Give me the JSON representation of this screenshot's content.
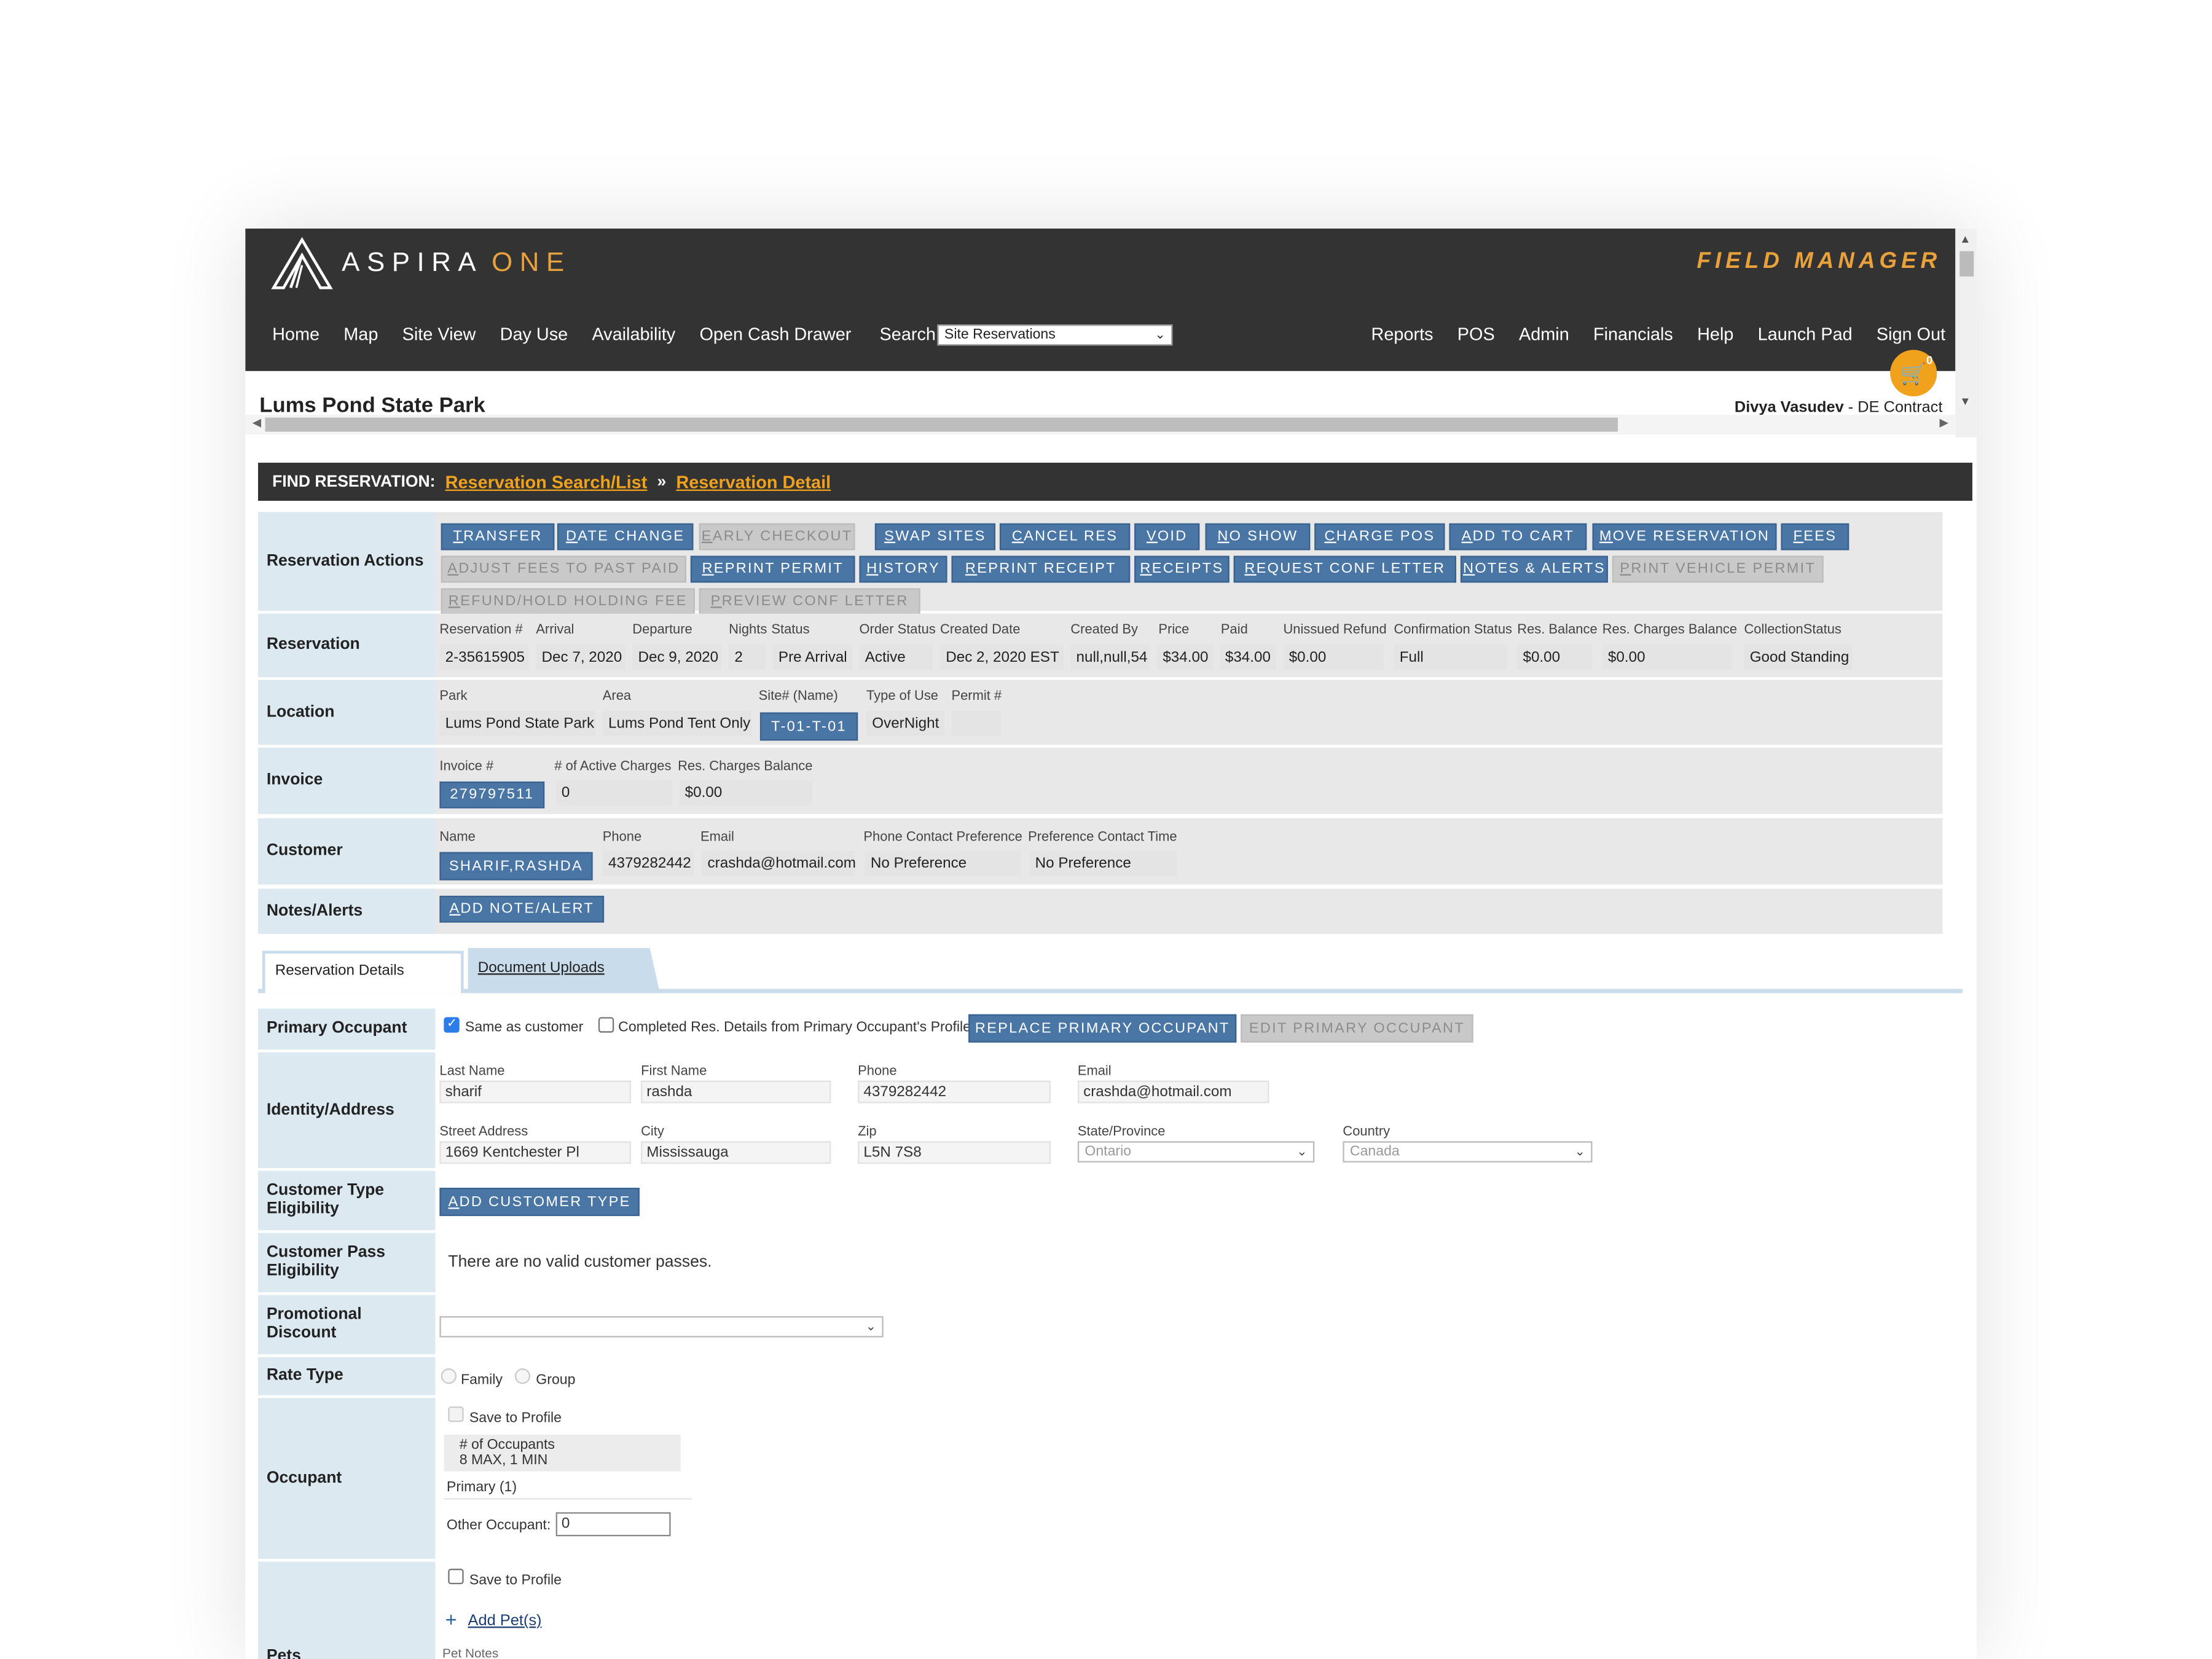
{
  "app": {
    "logo_word1": "ASPIRA",
    "logo_word2": "ONE",
    "product": "FIELD MANAGER"
  },
  "nav": {
    "left": [
      "Home",
      "Map",
      "Site View",
      "Day Use",
      "Availability",
      "Open Cash Drawer"
    ],
    "search_label": "Search:",
    "search_value": "Site Reservations",
    "right": [
      "Reports",
      "POS",
      "Admin",
      "Financials",
      "Help",
      "Launch Pad",
      "Sign Out"
    ]
  },
  "cart": {
    "count": "0"
  },
  "header": {
    "park": "Lums Pond State Park",
    "user_name": "Divya Vasudev",
    "user_role": " - DE Contract"
  },
  "find": {
    "label": "FIND RESERVATION:",
    "crumb1": "Reservation Search/List",
    "sep": "»",
    "crumb2": "Reservation Detail"
  },
  "actions": {
    "label": "Reservation Actions",
    "row1": [
      {
        "u": "T",
        "rest": "RANSFER",
        "enabled": true
      },
      {
        "u": "D",
        "rest": "ATE CHANGE",
        "enabled": true
      },
      {
        "u": "E",
        "rest": "ARLY CHECKOUT",
        "enabled": false
      },
      {
        "u": "S",
        "rest": "WAP SITES",
        "enabled": true
      },
      {
        "u": "C",
        "rest": "ANCEL RES",
        "enabled": true
      },
      {
        "u": "V",
        "rest": "OID",
        "enabled": true
      },
      {
        "u": "N",
        "rest": "O SHOW",
        "enabled": true
      },
      {
        "u": "C",
        "rest": "HARGE POS",
        "enabled": true
      },
      {
        "u": "A",
        "rest": "DD TO CART",
        "enabled": true
      },
      {
        "u": "M",
        "rest": "OVE RESERVATION",
        "enabled": true
      },
      {
        "u": "F",
        "rest": "EES",
        "enabled": true
      }
    ],
    "row2": [
      {
        "u": "A",
        "rest": "DJUST FEES TO PAST PAID",
        "enabled": false
      },
      {
        "u": "R",
        "rest": "EPRINT PERMIT",
        "enabled": true
      },
      {
        "u": "H",
        "rest": "ISTORY",
        "enabled": true
      },
      {
        "u": "R",
        "rest": "EPRINT RECEIPT",
        "enabled": true
      },
      {
        "u": "R",
        "rest": "ECEIPTS",
        "enabled": true
      },
      {
        "u": "R",
        "rest": "EQUEST CONF LETTER",
        "enabled": true
      },
      {
        "u": "N",
        "rest": "OTES & ALERTS",
        "enabled": true
      },
      {
        "u": "P",
        "rest": "RINT VEHICLE PERMIT",
        "enabled": false
      }
    ],
    "row3": [
      {
        "u": "R",
        "rest": "EFUND/HOLD HOLDING FEE",
        "enabled": false
      },
      {
        "u": "P",
        "rest": "REVIEW CONF LETTER",
        "enabled": false
      }
    ]
  },
  "reservation": {
    "label": "Reservation",
    "headers": [
      "Reservation #",
      "Arrival",
      "Departure",
      "Nights",
      "Status",
      "Order Status",
      "Created Date",
      "Created By",
      "Price",
      "Paid",
      "Unissued Refund",
      "Confirmation Status",
      "Res. Balance",
      "Res. Charges Balance",
      "CollectionStatus"
    ],
    "values": [
      "2-35615905",
      "Dec 7, 2020",
      "Dec 9, 2020",
      "2",
      "Pre Arrival",
      "Active",
      "Dec 2, 2020 EST",
      "null,null,54",
      "$34.00",
      "$34.00",
      "$0.00",
      "Full",
      "$0.00",
      "$0.00",
      "Good Standing"
    ]
  },
  "location": {
    "label": "Location",
    "headers": [
      "Park",
      "Area",
      "Site# (Name)",
      "Type of Use",
      "Permit #"
    ],
    "park": "Lums Pond State Park",
    "area": "Lums Pond Tent Only",
    "site": "T-01-T-01",
    "type": "OverNight",
    "permit": ""
  },
  "invoice": {
    "label": "Invoice",
    "headers": [
      "Invoice #",
      "# of Active Charges",
      "Res. Charges Balance"
    ],
    "number": "279797511",
    "active": "0",
    "balance": "$0.00"
  },
  "customer": {
    "label": "Customer",
    "headers": [
      "Name",
      "Phone",
      "Email",
      "Phone Contact Preference",
      "Preference Contact Time"
    ],
    "name": "SHARIF,RASHDA",
    "phone": "4379282442",
    "email": "crashda@hotmail.com",
    "pref": "No Preference",
    "time": "No Preference"
  },
  "notes": {
    "label": "Notes/Alerts",
    "button_u": "A",
    "button_rest": "DD NOTE/ALERT"
  },
  "tabs": {
    "active": "Reservation Details",
    "other": "Document Uploads"
  },
  "primary": {
    "label": "Primary Occupant",
    "same": "Same as customer",
    "completed": "Completed Res. Details from Primary Occupant's Profile",
    "replace": "REPLACE PRIMARY OCCUPANT",
    "edit": "EDIT PRIMARY OCCUPANT"
  },
  "identity": {
    "label": "Identity/Address",
    "last_label": "Last Name",
    "last": "sharif",
    "first_label": "First Name",
    "first": "rashda",
    "phone_label": "Phone",
    "phone": "4379282442",
    "email_label": "Email",
    "email": "crashda@hotmail.com",
    "street_label": "Street Address",
    "street": "1669 Kentchester Pl",
    "city_label": "City",
    "city": "Mississauga",
    "zip_label": "Zip",
    "zip": "L5N 7S8",
    "state_label": "State/Province",
    "state": "Ontario",
    "country_label": "Country",
    "country": "Canada"
  },
  "ctype": {
    "label1": "Customer Type",
    "label2": "Eligibility",
    "button_u": "A",
    "button_rest": "DD CUSTOMER TYPE"
  },
  "cpass": {
    "label1": "Customer Pass",
    "label2": "Eligibility",
    "text": "There are no valid customer passes."
  },
  "promo": {
    "label1": "Promotional",
    "label2": "Discount",
    "value": ""
  },
  "rate": {
    "label": "Rate Type",
    "opt1": "Family",
    "opt2": "Group"
  },
  "occupant": {
    "label": "Occupant",
    "save": "Save to Profile",
    "count_label": "# of Occupants",
    "count_range": "8 MAX, 1 MIN",
    "primary": "Primary (1)",
    "other_label": "Other Occupant:",
    "other_value": "0"
  },
  "pets": {
    "label": "Pets",
    "save": "Save to Profile",
    "add_link": "Add Pet(s)",
    "notes_label": "Pet Notes"
  }
}
